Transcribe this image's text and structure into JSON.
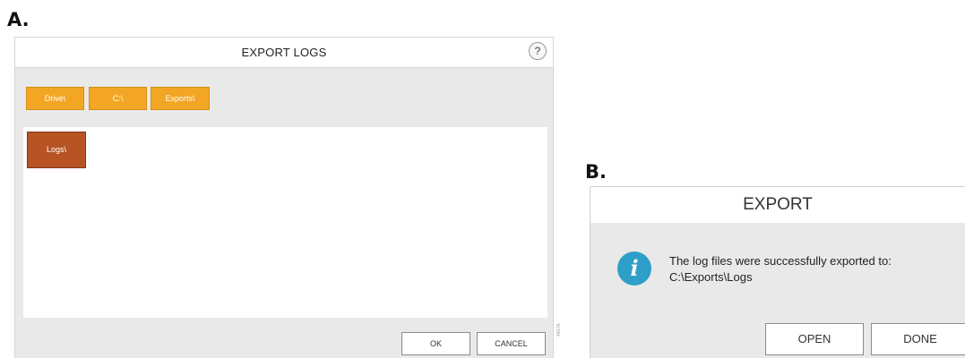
{
  "panel_a": {
    "label": "A.",
    "title": "EXPORT LOGS",
    "help_label": "?",
    "breadcrumbs": [
      "Drive\\",
      "C:\\",
      "Exports\\"
    ],
    "folders": [
      "Logs\\"
    ],
    "ok_label": "OK",
    "cancel_label": "CANCEL",
    "side_id": "4667A",
    "colors": {
      "breadcrumb": "#f2a623",
      "folder": "#b85424"
    }
  },
  "panel_b": {
    "label": "B.",
    "title": "EXPORT",
    "message_line1": "The log files were successfully exported to:",
    "message_line2": "C:\\Exports\\Logs",
    "icon": "info-icon",
    "icon_glyph": "i",
    "open_label": "OPEN",
    "done_label": "DONE",
    "colors": {
      "info_icon": "#2e9fc8"
    }
  }
}
